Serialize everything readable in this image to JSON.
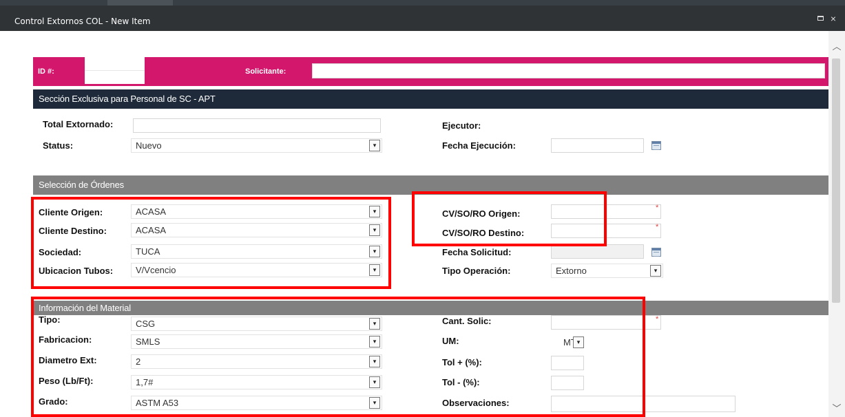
{
  "window": {
    "title": "Control Extornos COL - New Item",
    "maximize_icon": "maximize-icon",
    "close_icon": "close-icon",
    "close_glyph": "×"
  },
  "header_bar": {
    "id_label": "ID #:",
    "id_value": "",
    "solicitante_label": "Solicitante:",
    "solicitante_value": "",
    "color": "#d3176c"
  },
  "section_sc": {
    "title": "Sección Exclusiva para Personal de SC - APT",
    "total_extornado_label": "Total Extornado:",
    "total_extornado_value": "",
    "status_label": "Status:",
    "status_value": "Nuevo",
    "ejecutor_label": "Ejecutor:",
    "fecha_ejecucion_label": "Fecha Ejecución:",
    "fecha_ejecucion_value": ""
  },
  "section_ordenes": {
    "title": "Selección de Órdenes",
    "cliente_origen_label": "Cliente Origen:",
    "cliente_origen_value": "ACASA",
    "cliente_destino_label": "Cliente Destino:",
    "cliente_destino_value": "ACASA",
    "sociedad_label": "Sociedad:",
    "sociedad_value": "TUCA",
    "ubicacion_label": "Ubicacion Tubos:",
    "ubicacion_value": "V/Vcencio",
    "cv_origen_label": "CV/SO/RO Origen:",
    "cv_origen_value": "",
    "cv_destino_label": "CV/SO/RO Destino:",
    "cv_destino_value": "",
    "fecha_solicitud_label": "Fecha Solicitud:",
    "fecha_solicitud_value": "",
    "tipo_operacion_label": "Tipo Operación:",
    "tipo_operacion_value": "Extorno"
  },
  "section_material": {
    "title": "Información del Material",
    "tipo_label": "Tipo:",
    "tipo_value": "CSG",
    "fabricacion_label": "Fabricacion:",
    "fabricacion_value": "SMLS",
    "diametro_label": "Diametro Ext:",
    "diametro_value": "2",
    "peso_label": "Peso (Lb/Ft):",
    "peso_value": "1,7#",
    "grado_label": "Grado:",
    "grado_value": "ASTM A53",
    "cant_label": "Cant. Solic:",
    "cant_value": "",
    "um_label": "UM:",
    "um_value": "MT",
    "tol_plus_label": "Tol + (%):",
    "tol_plus_value": "",
    "tol_minus_label": "Tol - (%):",
    "tol_minus_value": "",
    "observaciones_label": "Observaciones:",
    "observaciones_value": ""
  },
  "glyphs": {
    "dropdown_arrow": "▾",
    "required_marker": "*",
    "scroll_up": "︿",
    "scroll_down": "﹀"
  },
  "colors": {
    "title_bar": "#2f3336",
    "section_dark": "#1e2a3a",
    "section_gray": "#808080",
    "highlight_red": "#ff0000"
  }
}
